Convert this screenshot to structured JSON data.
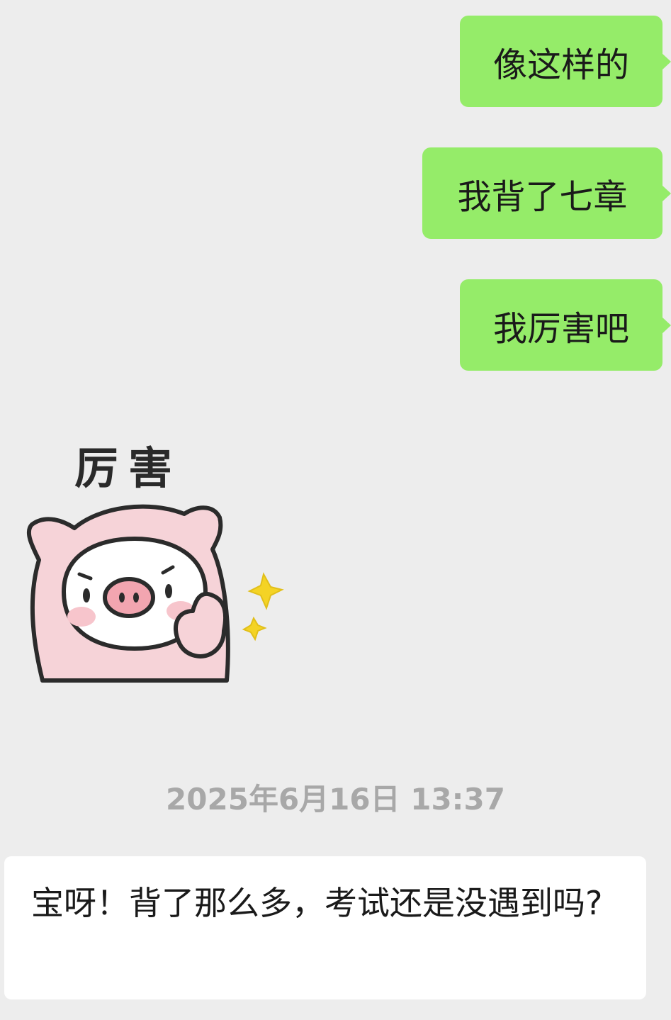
{
  "messages": {
    "sent": [
      "像这样的",
      "我背了七章",
      "我厉害吧"
    ],
    "sticker_caption": "厉害",
    "timestamp": "2025年6月16日 13:37",
    "received": "宝呀！背了那么多，考试还是没遇到吗?"
  },
  "colors": {
    "background": "#ededed",
    "sent_bubble": "#95ec69",
    "received_bubble": "#ffffff",
    "timestamp_text": "#a8a8a8"
  },
  "icons": {
    "sticker": "pig-thumbs-up-sticker"
  }
}
